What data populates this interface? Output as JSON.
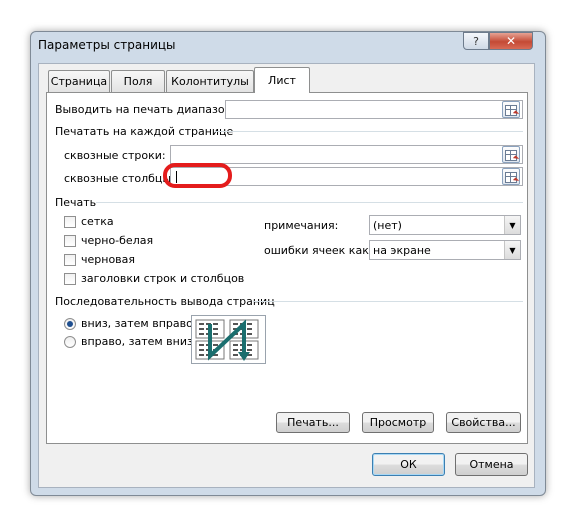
{
  "window": {
    "title": "Параметры страницы",
    "help_label": "?",
    "close_label": "✕"
  },
  "tabs": [
    {
      "label": "Страница",
      "active": false
    },
    {
      "label": "Поля",
      "active": false
    },
    {
      "label": "Колонтитулы",
      "active": false
    },
    {
      "label": "Лист",
      "active": true
    }
  ],
  "print_area": {
    "label": "Выводить на печать диапазон:",
    "value": ""
  },
  "print_titles": {
    "heading": "Печатать на каждой странице",
    "rows_label": "сквозные строки:",
    "rows_value": "",
    "cols_label": "сквозные столбцы:",
    "cols_value": ""
  },
  "print": {
    "heading": "Печать",
    "checkboxes": [
      {
        "label": "сетка",
        "checked": false
      },
      {
        "label": "черно-белая",
        "checked": false
      },
      {
        "label": "черновая",
        "checked": false
      },
      {
        "label": "заголовки строк и столбцов",
        "checked": false
      }
    ],
    "comments_label": "примечания:",
    "comments_value": "(нет)",
    "errors_label": "ошибки ячеек как:",
    "errors_value": "на экране"
  },
  "page_order": {
    "heading": "Последовательность вывода страниц",
    "options": [
      {
        "label": "вниз, затем вправо",
        "selected": true
      },
      {
        "label": "вправо, затем вниз",
        "selected": false
      }
    ]
  },
  "buttons": {
    "print": "Печать...",
    "preview": "Просмотр",
    "properties": "Свойства...",
    "ok": "ОК",
    "cancel": "Отмена"
  },
  "colors": {
    "highlight": "#e41c1c",
    "arrow": "#1a6e6e"
  }
}
